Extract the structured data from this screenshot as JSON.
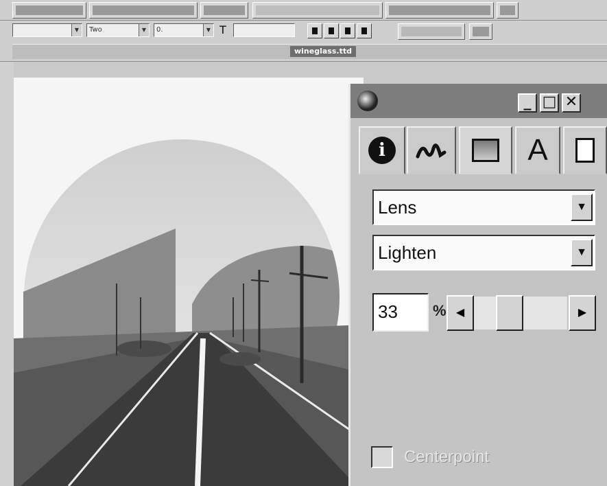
{
  "window": {
    "document_title": "wineglass.ttd"
  },
  "toolbar2": {
    "combo1": "",
    "combo2": "Two",
    "combo3": "0.",
    "text_tool_glyph": "T"
  },
  "palette": {
    "tabs": [
      {
        "name": "info",
        "glyph": "i"
      },
      {
        "name": "stroke",
        "glyph": "~"
      },
      {
        "name": "fill",
        "glyph": ""
      },
      {
        "name": "text",
        "glyph": "A"
      },
      {
        "name": "document",
        "glyph": ""
      }
    ],
    "active_tab": "fill",
    "lens_type": "Lens",
    "blend_mode": "Lighten",
    "amount": "33",
    "amount_unit": "%",
    "slider_value_percent": 33,
    "checkbox_label": "Centerpoint",
    "checkbox_checked": false
  },
  "colors": {
    "titlebar": "#7d7d7d",
    "panel": "#c4c4c4"
  }
}
